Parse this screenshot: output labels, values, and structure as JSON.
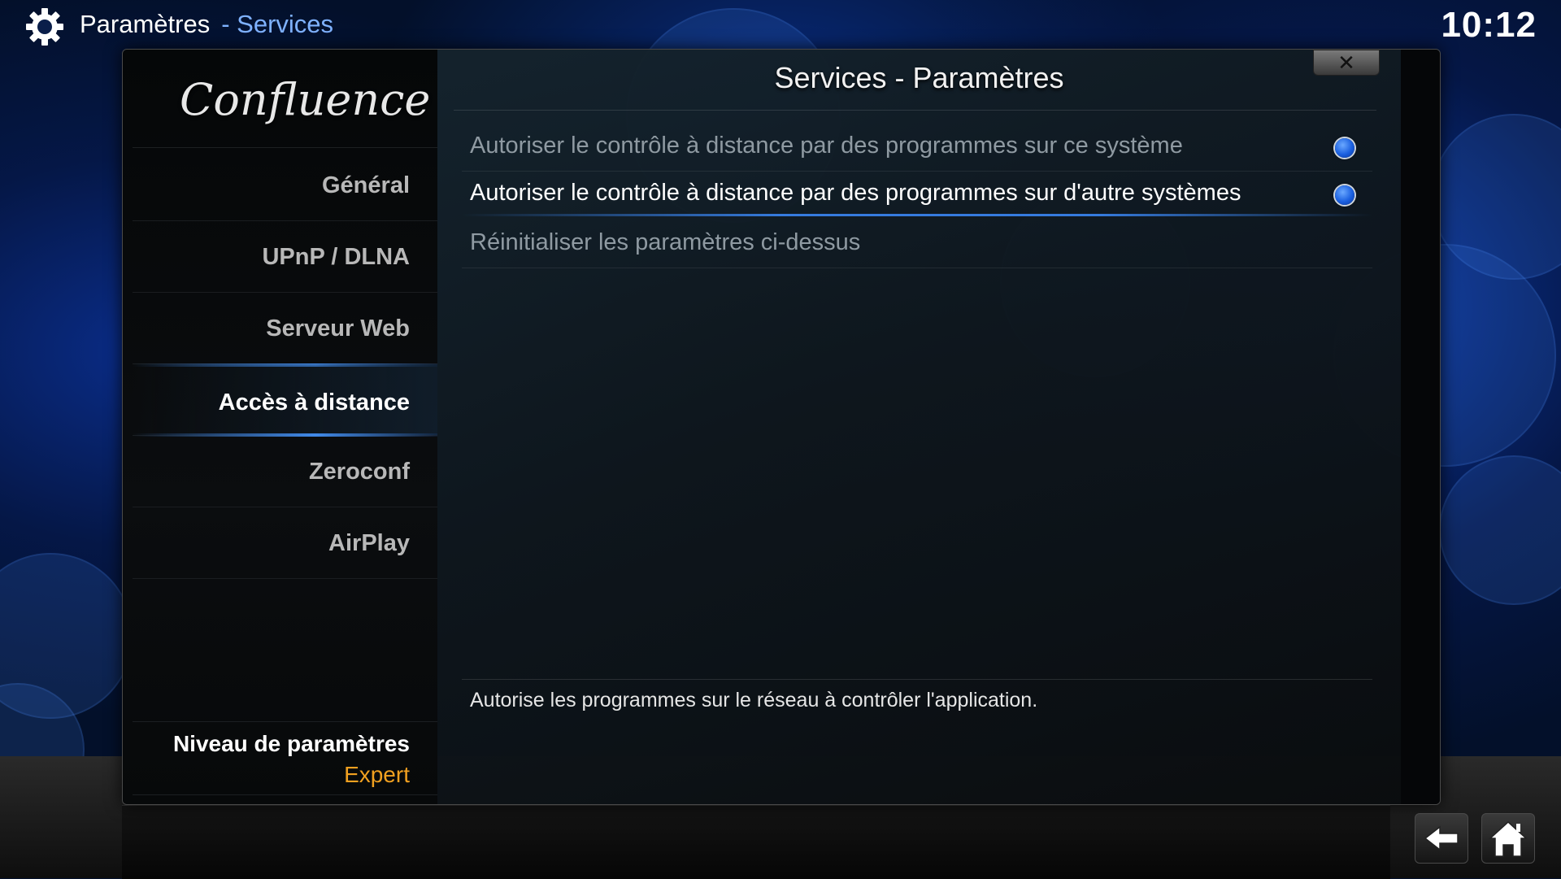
{
  "header": {
    "section": "Paramètres",
    "subsection": "- Services",
    "time": "10:12",
    "icon": "gear-icon"
  },
  "panel": {
    "title": "Services - Paramètres",
    "close_label": "✕"
  },
  "logo": {
    "text": "Confluence"
  },
  "sidebar": {
    "items": [
      {
        "label": "Général",
        "selected": false
      },
      {
        "label": "UPnP / DLNA",
        "selected": false
      },
      {
        "label": "Serveur Web",
        "selected": false
      },
      {
        "label": "Accès à distance",
        "selected": true
      },
      {
        "label": "Zeroconf",
        "selected": false
      },
      {
        "label": "AirPlay",
        "selected": false
      }
    ],
    "level_label": "Niveau de paramètres",
    "level_value": "Expert"
  },
  "settings": [
    {
      "label": "Autoriser le contrôle à distance par des programmes sur ce système",
      "enabled": true,
      "focused": false
    },
    {
      "label": "Autoriser le contrôle à distance par des programmes sur d'autre systèmes",
      "enabled": true,
      "focused": true
    },
    {
      "label": "Réinitialiser les paramètres ci-dessus",
      "focused": false
    }
  ],
  "description": "Autorise les programmes sur le réseau à contrôler l'application.",
  "footer": {
    "back_icon": "back-arrow-icon",
    "home_icon": "home-icon"
  },
  "colors": {
    "accent": "#3c8cff",
    "level_value": "#f0a020"
  }
}
